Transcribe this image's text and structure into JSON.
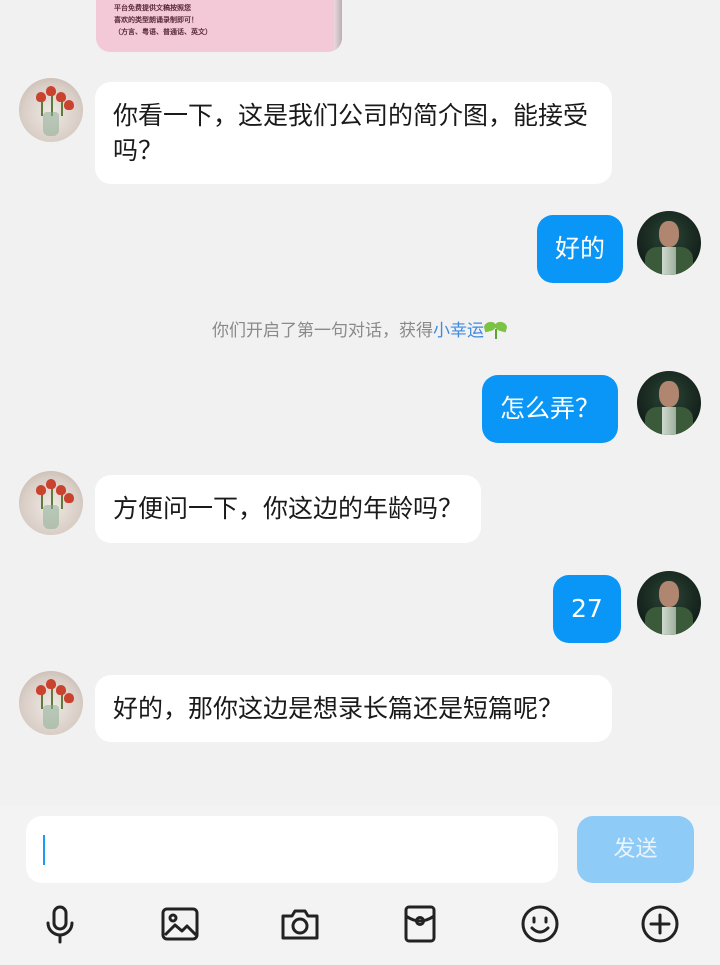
{
  "messages": [
    {
      "side": "left",
      "text": "你看一下，这是我们公司的简介图，能接受吗？"
    },
    {
      "side": "right",
      "text": "好的"
    },
    {
      "side": "right",
      "text": "怎么弄？"
    },
    {
      "side": "left",
      "text": "方便问一下，你这边的年龄吗？"
    },
    {
      "side": "right",
      "text": "27"
    },
    {
      "side": "left",
      "text": "好的，那你这边是想录长篇还是短篇呢？"
    }
  ],
  "top_image": {
    "lines": [
      "平台免费提供文稿按照您",
      "喜欢的类型朗诵录制即可！",
      "（方言、粤语、普通话、英文）"
    ]
  },
  "system_notice": {
    "prefix": "你们开启了第一句对话，获得",
    "highlight": "小幸运",
    "icon": "sprout-icon"
  },
  "composer": {
    "input_value": "",
    "send_label": "发送"
  },
  "toolbar": [
    "microphone-icon",
    "image-icon",
    "camera-icon",
    "red-packet-icon",
    "emoji-icon",
    "plus-icon"
  ],
  "colors": {
    "accent": "#0a96f6",
    "send_disabled": "#8ecbf7",
    "background": "#f1f1f1",
    "highlight": "#3f8ae0"
  }
}
